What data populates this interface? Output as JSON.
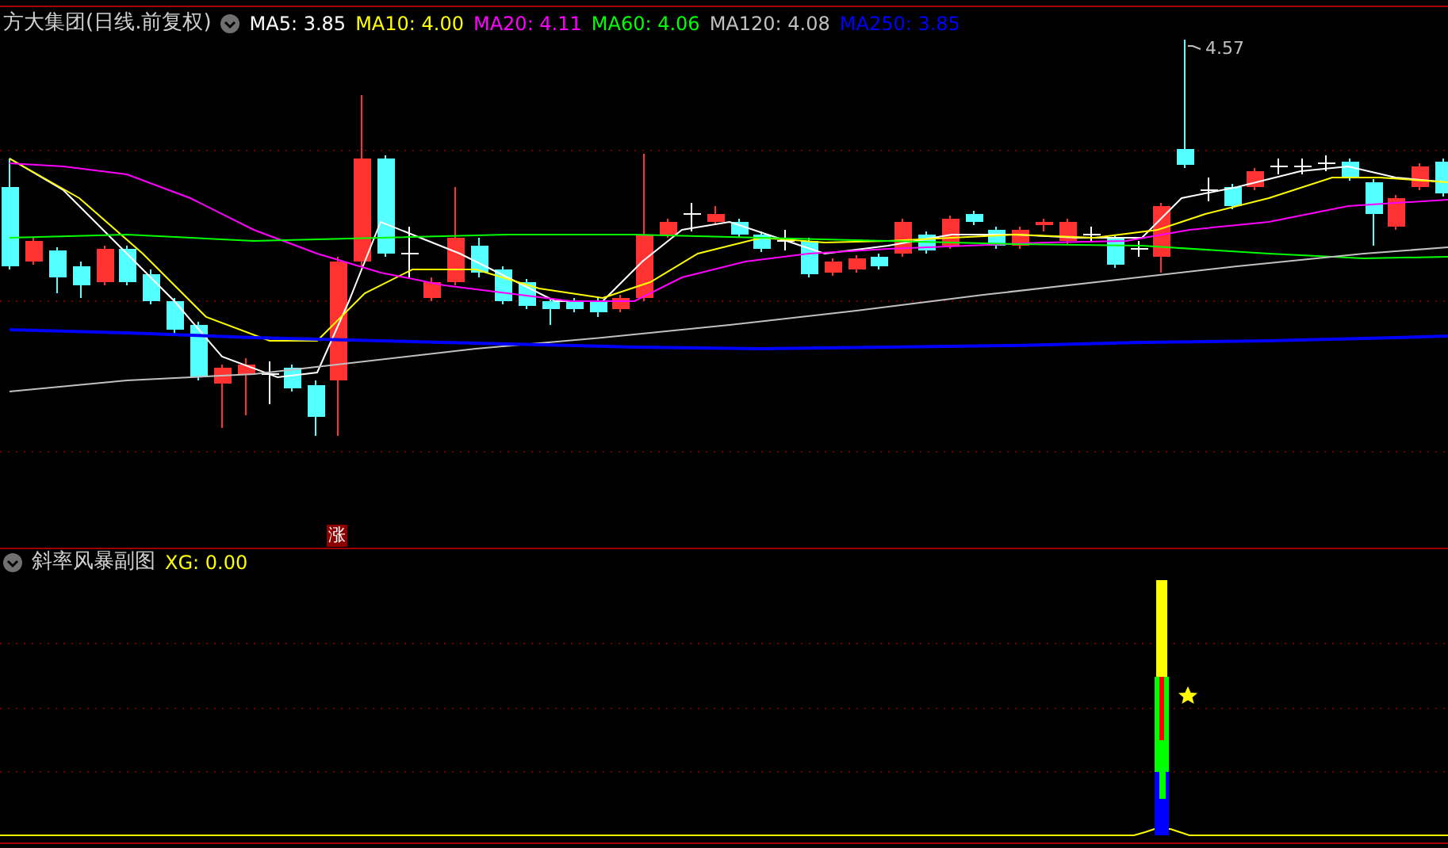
{
  "main_chart": {
    "title": "方大集团(日线.前复权)",
    "legend": [
      {
        "label": "MA5: 3.85",
        "color": "#ffffff"
      },
      {
        "label": "MA10: 4.00",
        "color": "#ffff00"
      },
      {
        "label": "MA20: 4.11",
        "color": "#ff00ff"
      },
      {
        "label": "MA60: 4.06",
        "color": "#00ff00"
      },
      {
        "label": "MA120: 4.08",
        "color": "#c0c0c0"
      },
      {
        "label": "MA250: 3.85",
        "color": "#0000ff"
      }
    ],
    "high_label": "4.57",
    "marker": "涨"
  },
  "sub_chart": {
    "title": "斜率风暴副图",
    "legend": [
      {
        "label": "XG: 0.00",
        "color": "#ffff00"
      }
    ]
  }
}
